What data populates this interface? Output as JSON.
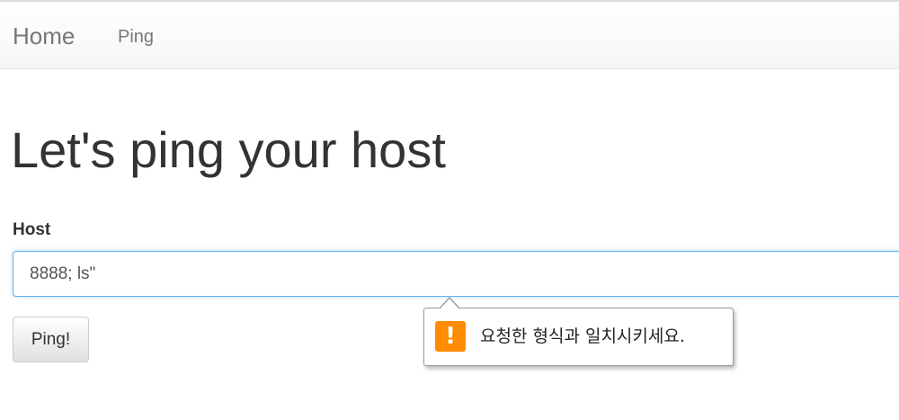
{
  "navbar": {
    "brand": "Home",
    "links": [
      {
        "label": "Ping"
      }
    ]
  },
  "main": {
    "title": "Let's ping your host",
    "host_label": "Host",
    "host_value": "8888; ls\"",
    "ping_button": "Ping!"
  },
  "validation_tooltip": {
    "icon": "warning-icon",
    "message": "요청한 형식과 일치시키세요.",
    "icon_color": "#ff8c00"
  },
  "colors": {
    "input_focus_border": "#66afe9",
    "navbar_text": "#777777"
  }
}
